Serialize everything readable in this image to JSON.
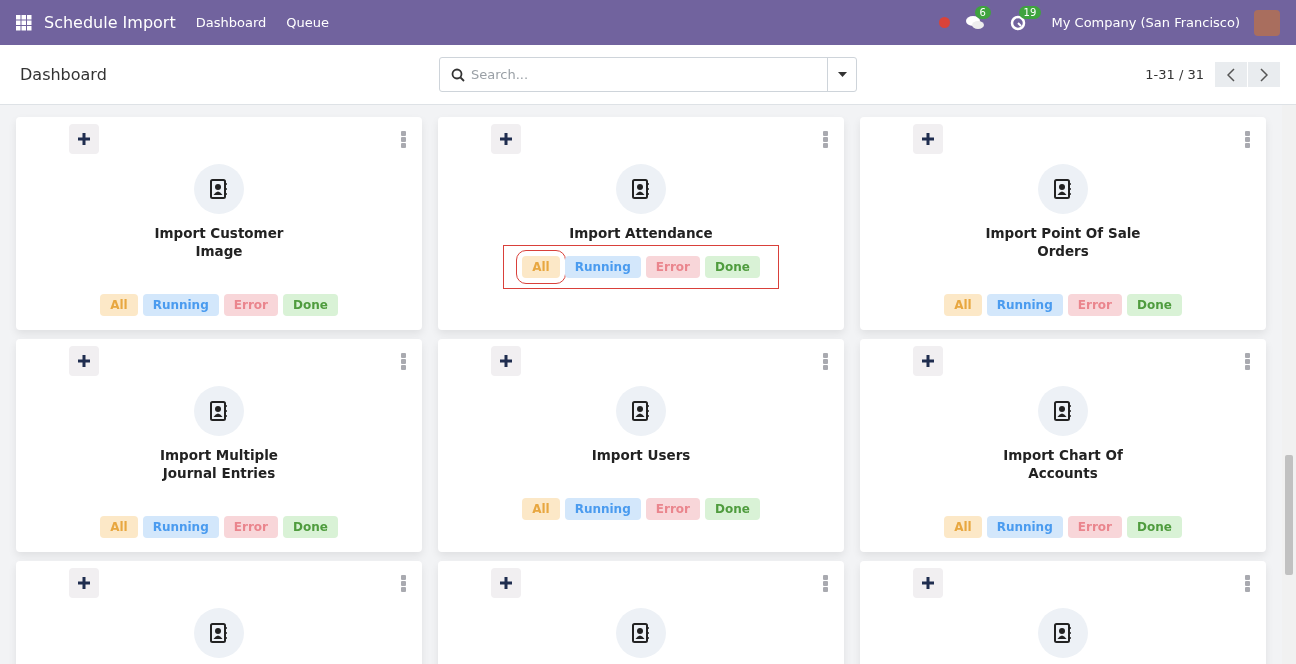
{
  "navbar": {
    "app_name": "Schedule Import",
    "menu": [
      {
        "label": "Dashboard"
      },
      {
        "label": "Queue"
      }
    ],
    "messages_count": "6",
    "activities_count": "19",
    "company": "My Company (San Francisco)"
  },
  "control_panel": {
    "breadcrumb": "Dashboard",
    "search": {
      "placeholder": "Search..."
    },
    "pager": "1-31 / 31"
  },
  "cards": [
    {
      "kind": "full",
      "title": "Import Customer\nImage",
      "filters_highlighted": false,
      "filters": [
        {
          "kind": "all",
          "label": "All",
          "highlighted": false
        },
        {
          "kind": "running",
          "label": "Running",
          "highlighted": false
        },
        {
          "kind": "error",
          "label": "Error",
          "highlighted": false
        },
        {
          "kind": "done",
          "label": "Done",
          "highlighted": false
        }
      ]
    },
    {
      "kind": "full",
      "title": "Import Attendance",
      "filters_highlighted": true,
      "filters": [
        {
          "kind": "all",
          "label": "All",
          "highlighted": true
        },
        {
          "kind": "running",
          "label": "Running",
          "highlighted": false
        },
        {
          "kind": "error",
          "label": "Error",
          "highlighted": false
        },
        {
          "kind": "done",
          "label": "Done",
          "highlighted": false
        }
      ]
    },
    {
      "kind": "full",
      "title": "Import Point Of Sale\nOrders",
      "filters_highlighted": false,
      "filters": [
        {
          "kind": "all",
          "label": "All",
          "highlighted": false
        },
        {
          "kind": "running",
          "label": "Running",
          "highlighted": false
        },
        {
          "kind": "error",
          "label": "Error",
          "highlighted": false
        },
        {
          "kind": "done",
          "label": "Done",
          "highlighted": false
        }
      ]
    },
    {
      "kind": "full",
      "title": "Import Multiple\nJournal Entries",
      "filters_highlighted": false,
      "filters": [
        {
          "kind": "all",
          "label": "All",
          "highlighted": false
        },
        {
          "kind": "running",
          "label": "Running",
          "highlighted": false
        },
        {
          "kind": "error",
          "label": "Error",
          "highlighted": false
        },
        {
          "kind": "done",
          "label": "Done",
          "highlighted": false
        }
      ]
    },
    {
      "kind": "full",
      "title": "Import Users",
      "filters_highlighted": false,
      "filters": [
        {
          "kind": "all",
          "label": "All",
          "highlighted": false
        },
        {
          "kind": "running",
          "label": "Running",
          "highlighted": false
        },
        {
          "kind": "error",
          "label": "Error",
          "highlighted": false
        },
        {
          "kind": "done",
          "label": "Done",
          "highlighted": false
        }
      ]
    },
    {
      "kind": "full",
      "title": "Import Chart Of\nAccounts",
      "filters_highlighted": false,
      "filters": [
        {
          "kind": "all",
          "label": "All",
          "highlighted": false
        },
        {
          "kind": "running",
          "label": "Running",
          "highlighted": false
        },
        {
          "kind": "error",
          "label": "Error",
          "highlighted": false
        },
        {
          "kind": "done",
          "label": "Done",
          "highlighted": false
        }
      ]
    },
    {
      "kind": "cut_off"
    },
    {
      "kind": "cut_off"
    },
    {
      "kind": "cut_off"
    }
  ]
}
